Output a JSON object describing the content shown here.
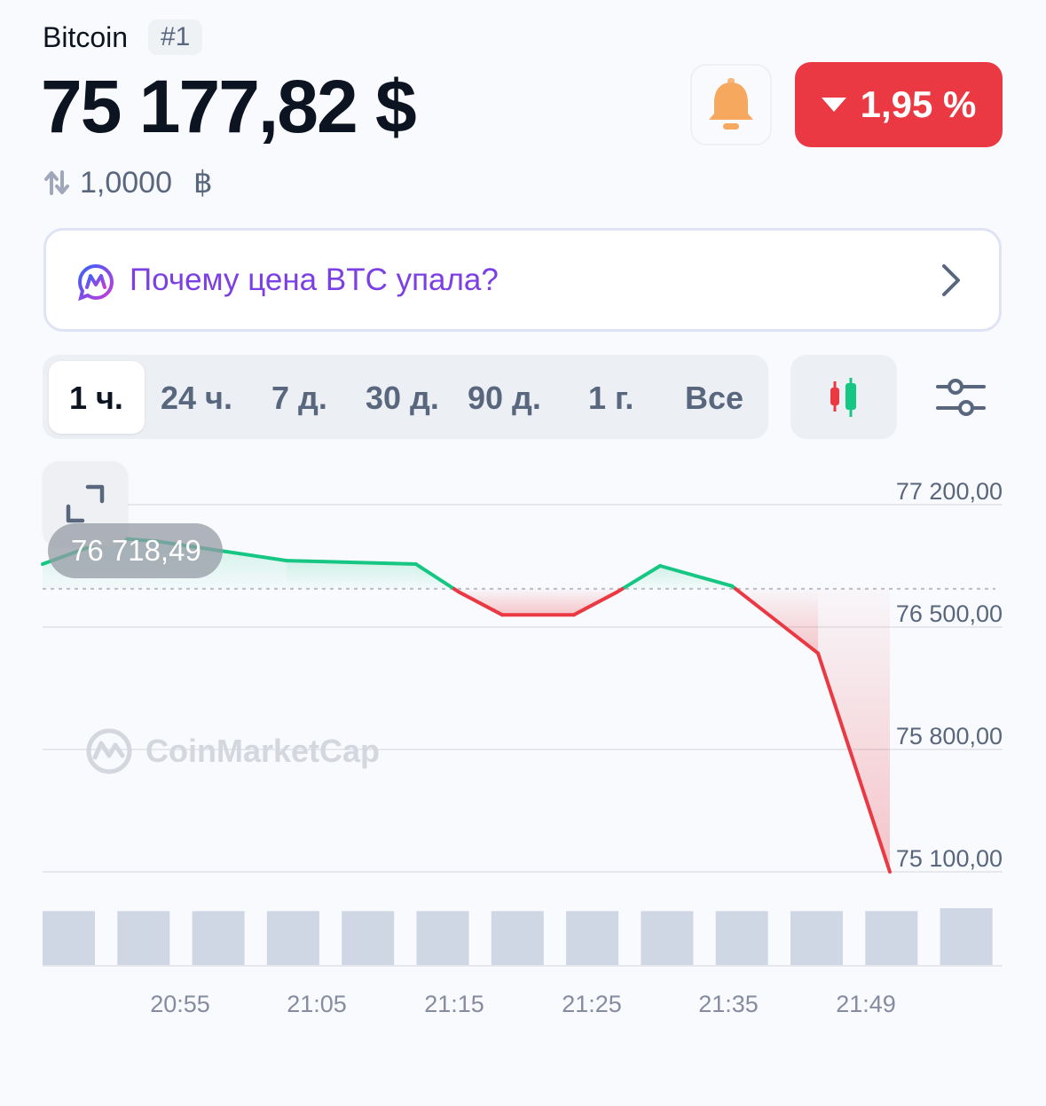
{
  "header": {
    "coin_name": "Bitcoin",
    "rank": "#1",
    "price": "75 177,82 $",
    "change_pct": "1,95 %",
    "change_direction": "down",
    "conversion": "1,0000",
    "conversion_unit": "฿"
  },
  "why_banner": {
    "text": "Почему цена BTC упала?"
  },
  "timeframes": {
    "tabs": [
      "1 ч.",
      "24 ч.",
      "7 д.",
      "30 д.",
      "90 д.",
      "1 г.",
      "Все"
    ],
    "active": "1 ч."
  },
  "chart": {
    "open_price_label": "76 718,49",
    "watermark": "CoinMarketCap",
    "colors": {
      "up": "#16c784",
      "down": "#ea3943",
      "badge": "#ea3943",
      "accent": "#7b3fe4"
    }
  },
  "chart_data": {
    "type": "line",
    "baseline": 76718.49,
    "y_ticks": [
      "77 200,00",
      "76 500,00",
      "75 800,00",
      "75 100,00"
    ],
    "ylim": [
      75100,
      77200
    ],
    "x_ticks": [
      "20:55",
      "21:05",
      "21:15",
      "21:25",
      "21:35",
      "21:49"
    ],
    "series": [
      {
        "x": [
          "20:50",
          "20:55",
          "20:58",
          "21:07",
          "21:16",
          "21:19",
          "21:22",
          "21:27",
          "21:30",
          "21:33",
          "21:38",
          "21:44",
          "21:49"
        ],
        "values": [
          76860,
          77010,
          76990,
          76880,
          76860,
          76700,
          76570,
          76570,
          76700,
          76850,
          76735,
          76350,
          75100
        ]
      }
    ],
    "volume": [
      0.95,
      0.95,
      0.95,
      0.95,
      0.95,
      0.95,
      0.95,
      0.95,
      0.95,
      0.95,
      0.95,
      0.95,
      1.0
    ],
    "grid": true
  }
}
